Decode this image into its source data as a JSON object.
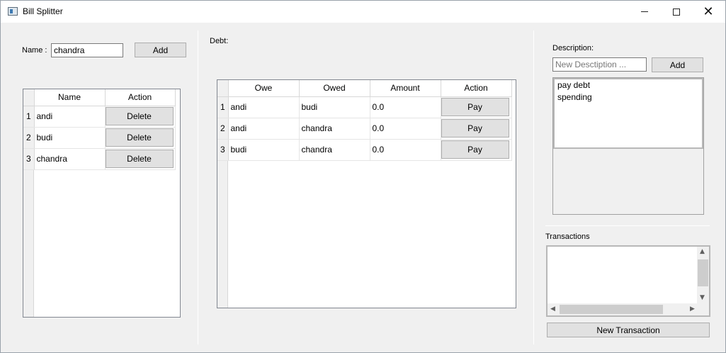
{
  "window": {
    "title": "Bill Splitter"
  },
  "people": {
    "name_label": "Name :",
    "name_value": "chandra",
    "add_label": "Add",
    "table": {
      "headers": [
        "Name",
        "Action"
      ],
      "rows": [
        {
          "num": "1",
          "name": "andi",
          "action": "Delete"
        },
        {
          "num": "2",
          "name": "budi",
          "action": "Delete"
        },
        {
          "num": "3",
          "name": "chandra",
          "action": "Delete"
        }
      ]
    }
  },
  "debt": {
    "label": "Debt:",
    "table": {
      "headers": [
        "Owe",
        "Owed",
        "Amount",
        "Action"
      ],
      "rows": [
        {
          "num": "1",
          "owe": "andi",
          "owed": "budi",
          "amount": "0.0",
          "action": "Pay"
        },
        {
          "num": "2",
          "owe": "andi",
          "owed": "chandra",
          "amount": "0.0",
          "action": "Pay"
        },
        {
          "num": "3",
          "owe": "budi",
          "owed": "chandra",
          "amount": "0.0",
          "action": "Pay"
        }
      ]
    }
  },
  "description": {
    "label": "Description:",
    "placeholder": "New Desctiption ...",
    "add_label": "Add",
    "items": [
      "pay debt",
      "spending"
    ]
  },
  "transactions": {
    "label": "Transactions",
    "new_button": "New Transaction"
  }
}
